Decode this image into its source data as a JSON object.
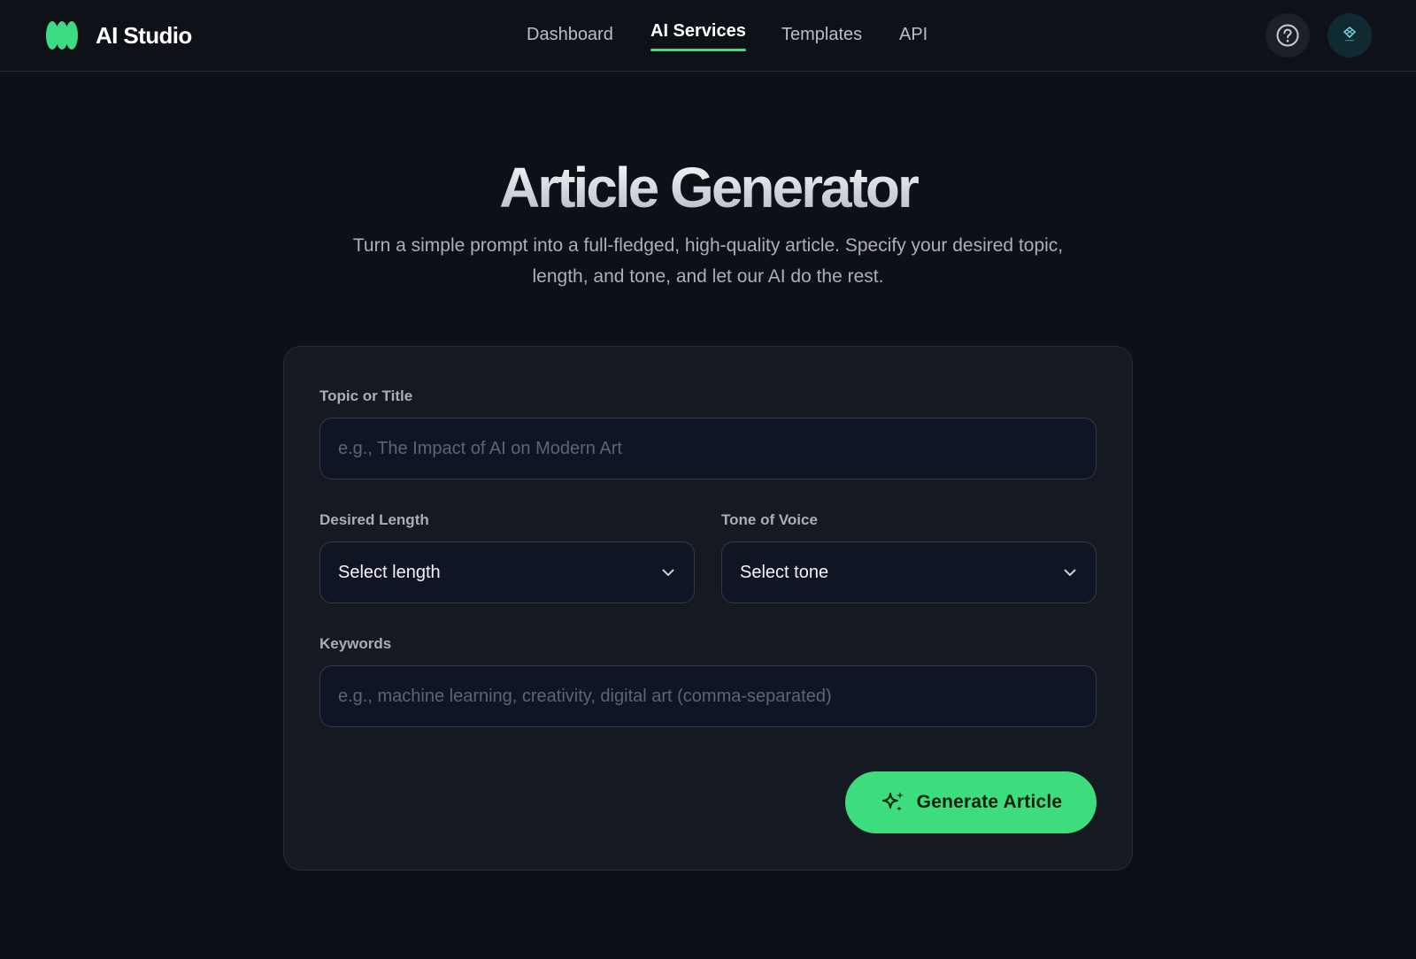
{
  "app": {
    "name": "AI Studio",
    "accent_color": "#3ddc84"
  },
  "nav": {
    "items": [
      {
        "label": "Dashboard",
        "active": false
      },
      {
        "label": "AI Services",
        "active": true
      },
      {
        "label": "Templates",
        "active": false
      },
      {
        "label": "API",
        "active": false
      }
    ]
  },
  "header_icons": {
    "help": "help-circle-icon",
    "avatar": "user-avatar"
  },
  "hero": {
    "title": "Article Generator",
    "subtitle": "Turn a simple prompt into a full-fledged, high-quality article. Specify your desired topic, length, and tone, and let our AI do the rest."
  },
  "form": {
    "topic": {
      "label": "Topic or Title",
      "value": "",
      "placeholder": "e.g., The Impact of AI on Modern Art"
    },
    "length": {
      "label": "Desired Length",
      "value": "Select length"
    },
    "tone": {
      "label": "Tone of Voice",
      "value": "Select tone"
    },
    "keywords": {
      "label": "Keywords",
      "value": "",
      "placeholder": "e.g., machine learning, creativity, digital art (comma-separated)"
    },
    "submit": {
      "label": "Generate Article",
      "icon": "sparkles-icon",
      "color": "#3ddc7c"
    }
  }
}
